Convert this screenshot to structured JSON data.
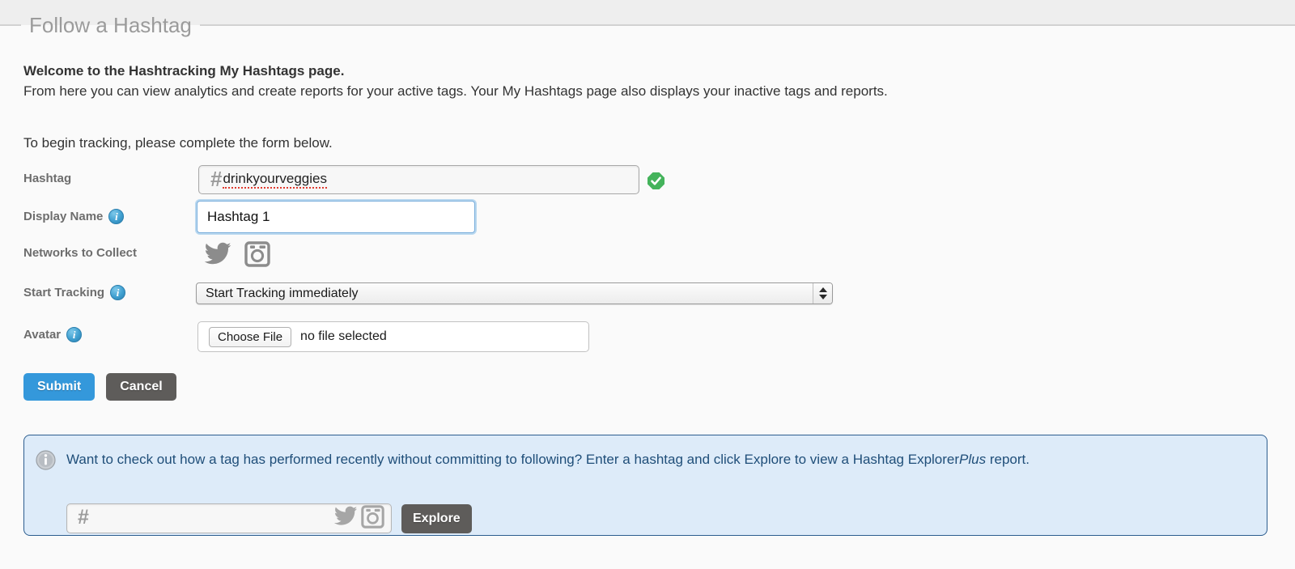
{
  "page": {
    "legend": "Follow a Hashtag"
  },
  "intro": {
    "heading": "Welcome to the Hashtracking My Hashtags page.",
    "body": "From here you can view analytics and create reports for your active tags. Your My Hashtags page also displays your inactive tags and reports.",
    "begin": "To begin tracking, please complete the form below."
  },
  "form": {
    "hashtag": {
      "label": "Hashtag",
      "prefix": "#",
      "value": "drinkyourveggies",
      "placeholder": "",
      "valid_icon": "green-check-icon"
    },
    "display_name": {
      "label": "Display Name",
      "value": "Hashtag 1",
      "placeholder": "",
      "info_icon": "info-icon"
    },
    "networks": {
      "label": "Networks to Collect",
      "items": [
        {
          "name": "twitter-icon",
          "label": "Twitter"
        },
        {
          "name": "instagram-icon",
          "label": "Instagram"
        }
      ]
    },
    "start_tracking": {
      "label": "Start Tracking",
      "selected": "Start Tracking immediately",
      "options": [
        "Start Tracking immediately"
      ],
      "info_icon": "info-icon"
    },
    "avatar": {
      "label": "Avatar",
      "button_label": "Choose File",
      "status": "no file selected",
      "info_icon": "info-icon"
    }
  },
  "actions": {
    "submit_label": "Submit",
    "cancel_label": "Cancel"
  },
  "callout": {
    "icon": "info-icon",
    "text_part1": "Want to check out how a tag has performed recently without committing to following? Enter a hashtag and click Explore to view a Hashtag Explorer",
    "text_italic": "Plus",
    "text_part2": " report.",
    "input_prefix": "#",
    "input_value": "",
    "input_placeholder": "",
    "explore_label": "Explore"
  },
  "colors": {
    "accent_blue": "#3498db",
    "cancel_gray": "#5e5c5a",
    "callout_bg": "#ddebf9",
    "callout_border": "#2c5d8f",
    "callout_text": "#1f4e79",
    "label_gray": "#6d6d6d",
    "valid_green": "#44b35b",
    "top_band": "#eeeeee",
    "page_bg": "#fafafa"
  }
}
